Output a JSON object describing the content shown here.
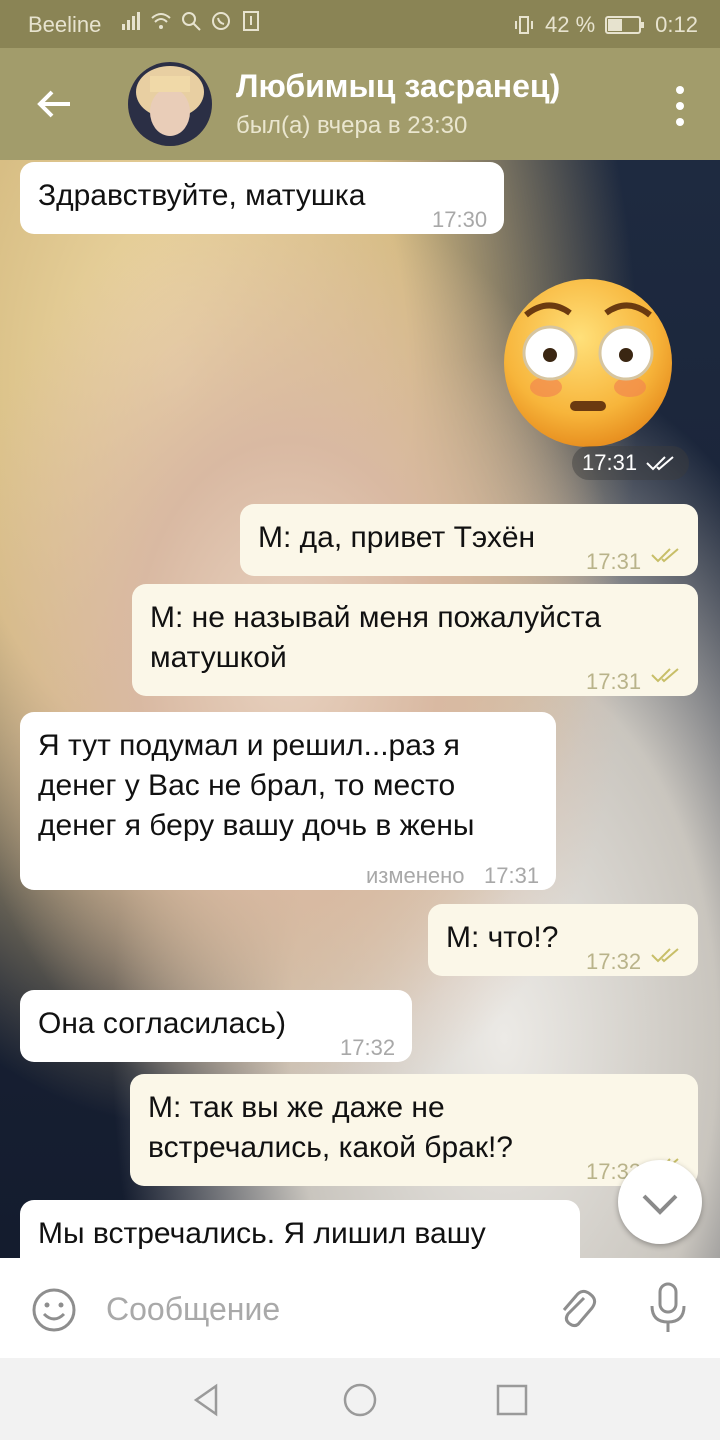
{
  "status_bar": {
    "carrier": "Beeline",
    "battery": "42 %",
    "time": "0:12",
    "icons": [
      "signal-icon",
      "wifi-icon",
      "search-icon",
      "whatsapp-icon",
      "download-icon",
      "vibrate-icon",
      "battery-icon"
    ]
  },
  "header": {
    "title": "Любимыц засранец)",
    "subtitle": "был(а) вчера в 23:30"
  },
  "messages": [
    {
      "direction": "in",
      "text": "Здравствуйте, матушка",
      "time": "17:30"
    },
    {
      "direction": "out",
      "type": "sticker",
      "sticker": "flushed-face",
      "time": "17:31",
      "read": true
    },
    {
      "direction": "out",
      "text": "М: да, привет Тэхён",
      "time": "17:31",
      "read": true
    },
    {
      "direction": "out",
      "text": "М: не называй меня пожалуйста матушкой",
      "time": "17:31",
      "read": true
    },
    {
      "direction": "in",
      "text": "Я тут подумал и решил...раз я денег у Вас не брал, то место денег я беру вашу дочь в жены",
      "edited_label": "изменено",
      "time": "17:31"
    },
    {
      "direction": "out",
      "text": "М: что!?",
      "time": "17:32",
      "read": true
    },
    {
      "direction": "in",
      "text": "Она согласилась)",
      "time": "17:32"
    },
    {
      "direction": "out",
      "text": "М: так вы же даже не встречались, какой брак!?",
      "time": "17:32",
      "read": true
    },
    {
      "direction": "in",
      "text": "Мы встречались. Я лишил вашу",
      "time": ""
    }
  ],
  "input": {
    "placeholder": "Сообщение"
  },
  "colors": {
    "status_bar": "#8a8455",
    "header": "#a29c6b",
    "outgoing_bubble": "#fbf7e8",
    "incoming_bubble": "#ffffff",
    "check_marks": "#c8bf68"
  }
}
